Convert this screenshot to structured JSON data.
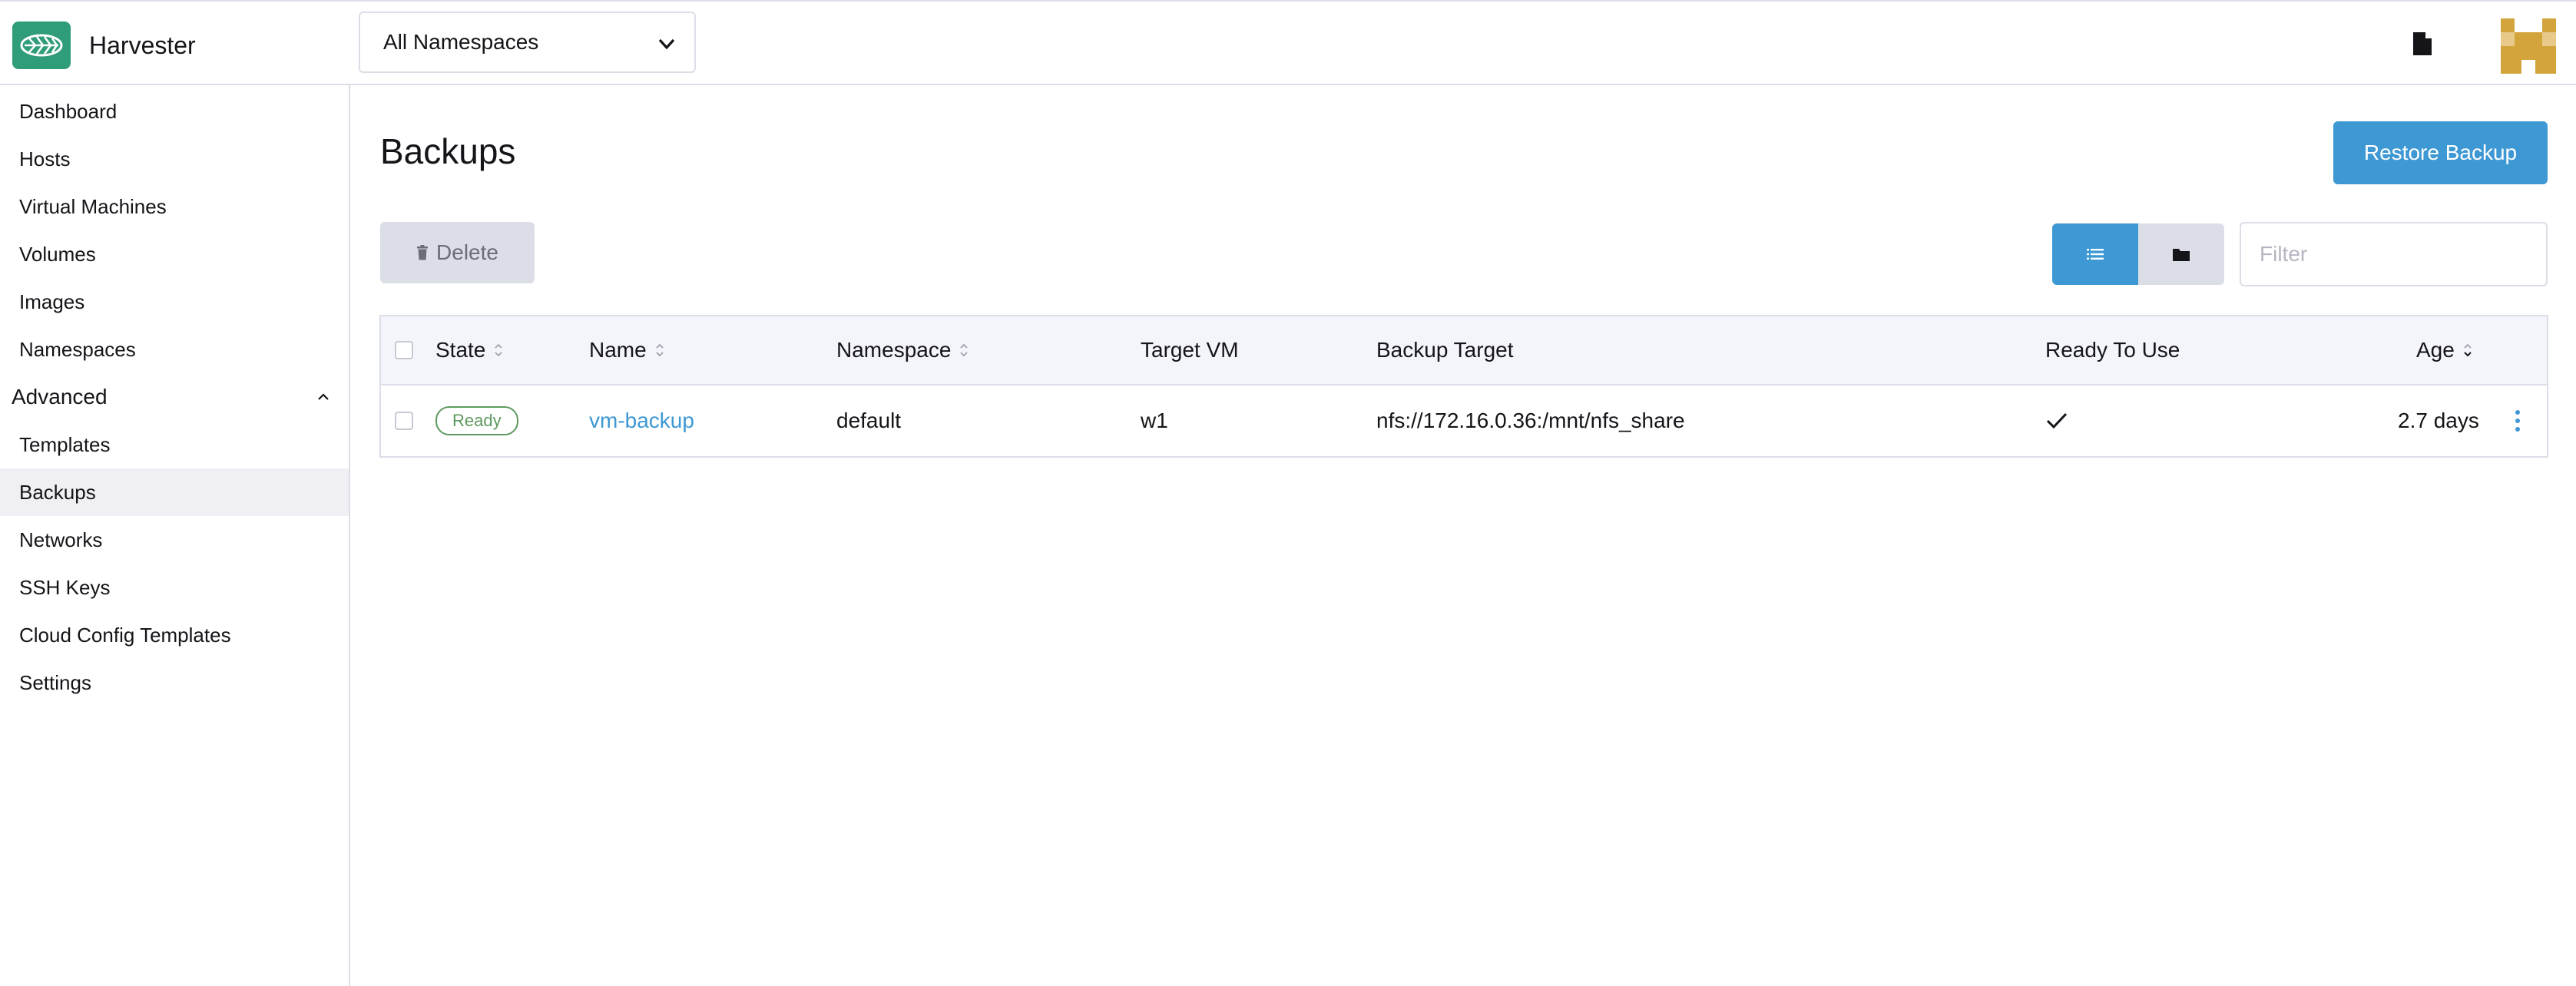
{
  "app": {
    "name": "Harvester",
    "namespace_select": "All Namespaces",
    "accent": "#3d98d3",
    "brand_color": "#2f9c7a"
  },
  "sidebar": {
    "items_top": [
      {
        "label": "Dashboard"
      },
      {
        "label": "Hosts"
      },
      {
        "label": "Virtual Machines"
      },
      {
        "label": "Volumes"
      },
      {
        "label": "Images"
      },
      {
        "label": "Namespaces"
      }
    ],
    "group_label": "Advanced",
    "items_advanced": [
      {
        "label": "Templates"
      },
      {
        "label": "Backups",
        "active": true
      },
      {
        "label": "Networks"
      },
      {
        "label": "SSH Keys"
      },
      {
        "label": "Cloud Config Templates"
      },
      {
        "label": "Settings"
      }
    ]
  },
  "main": {
    "title": "Backups",
    "restore_button": "Restore Backup",
    "delete_button": "Delete",
    "filter_placeholder": "Filter"
  },
  "table": {
    "headers": {
      "state": "State",
      "name": "Name",
      "namespace": "Namespace",
      "target_vm": "Target VM",
      "backup_target": "Backup Target",
      "ready": "Ready To Use",
      "age": "Age"
    },
    "rows": [
      {
        "state": "Ready",
        "name": "vm-backup",
        "namespace": "default",
        "target_vm": "w1",
        "backup_target": "nfs://172.16.0.36:/mnt/nfs_share",
        "ready": true,
        "age": "2.7 days"
      }
    ]
  }
}
